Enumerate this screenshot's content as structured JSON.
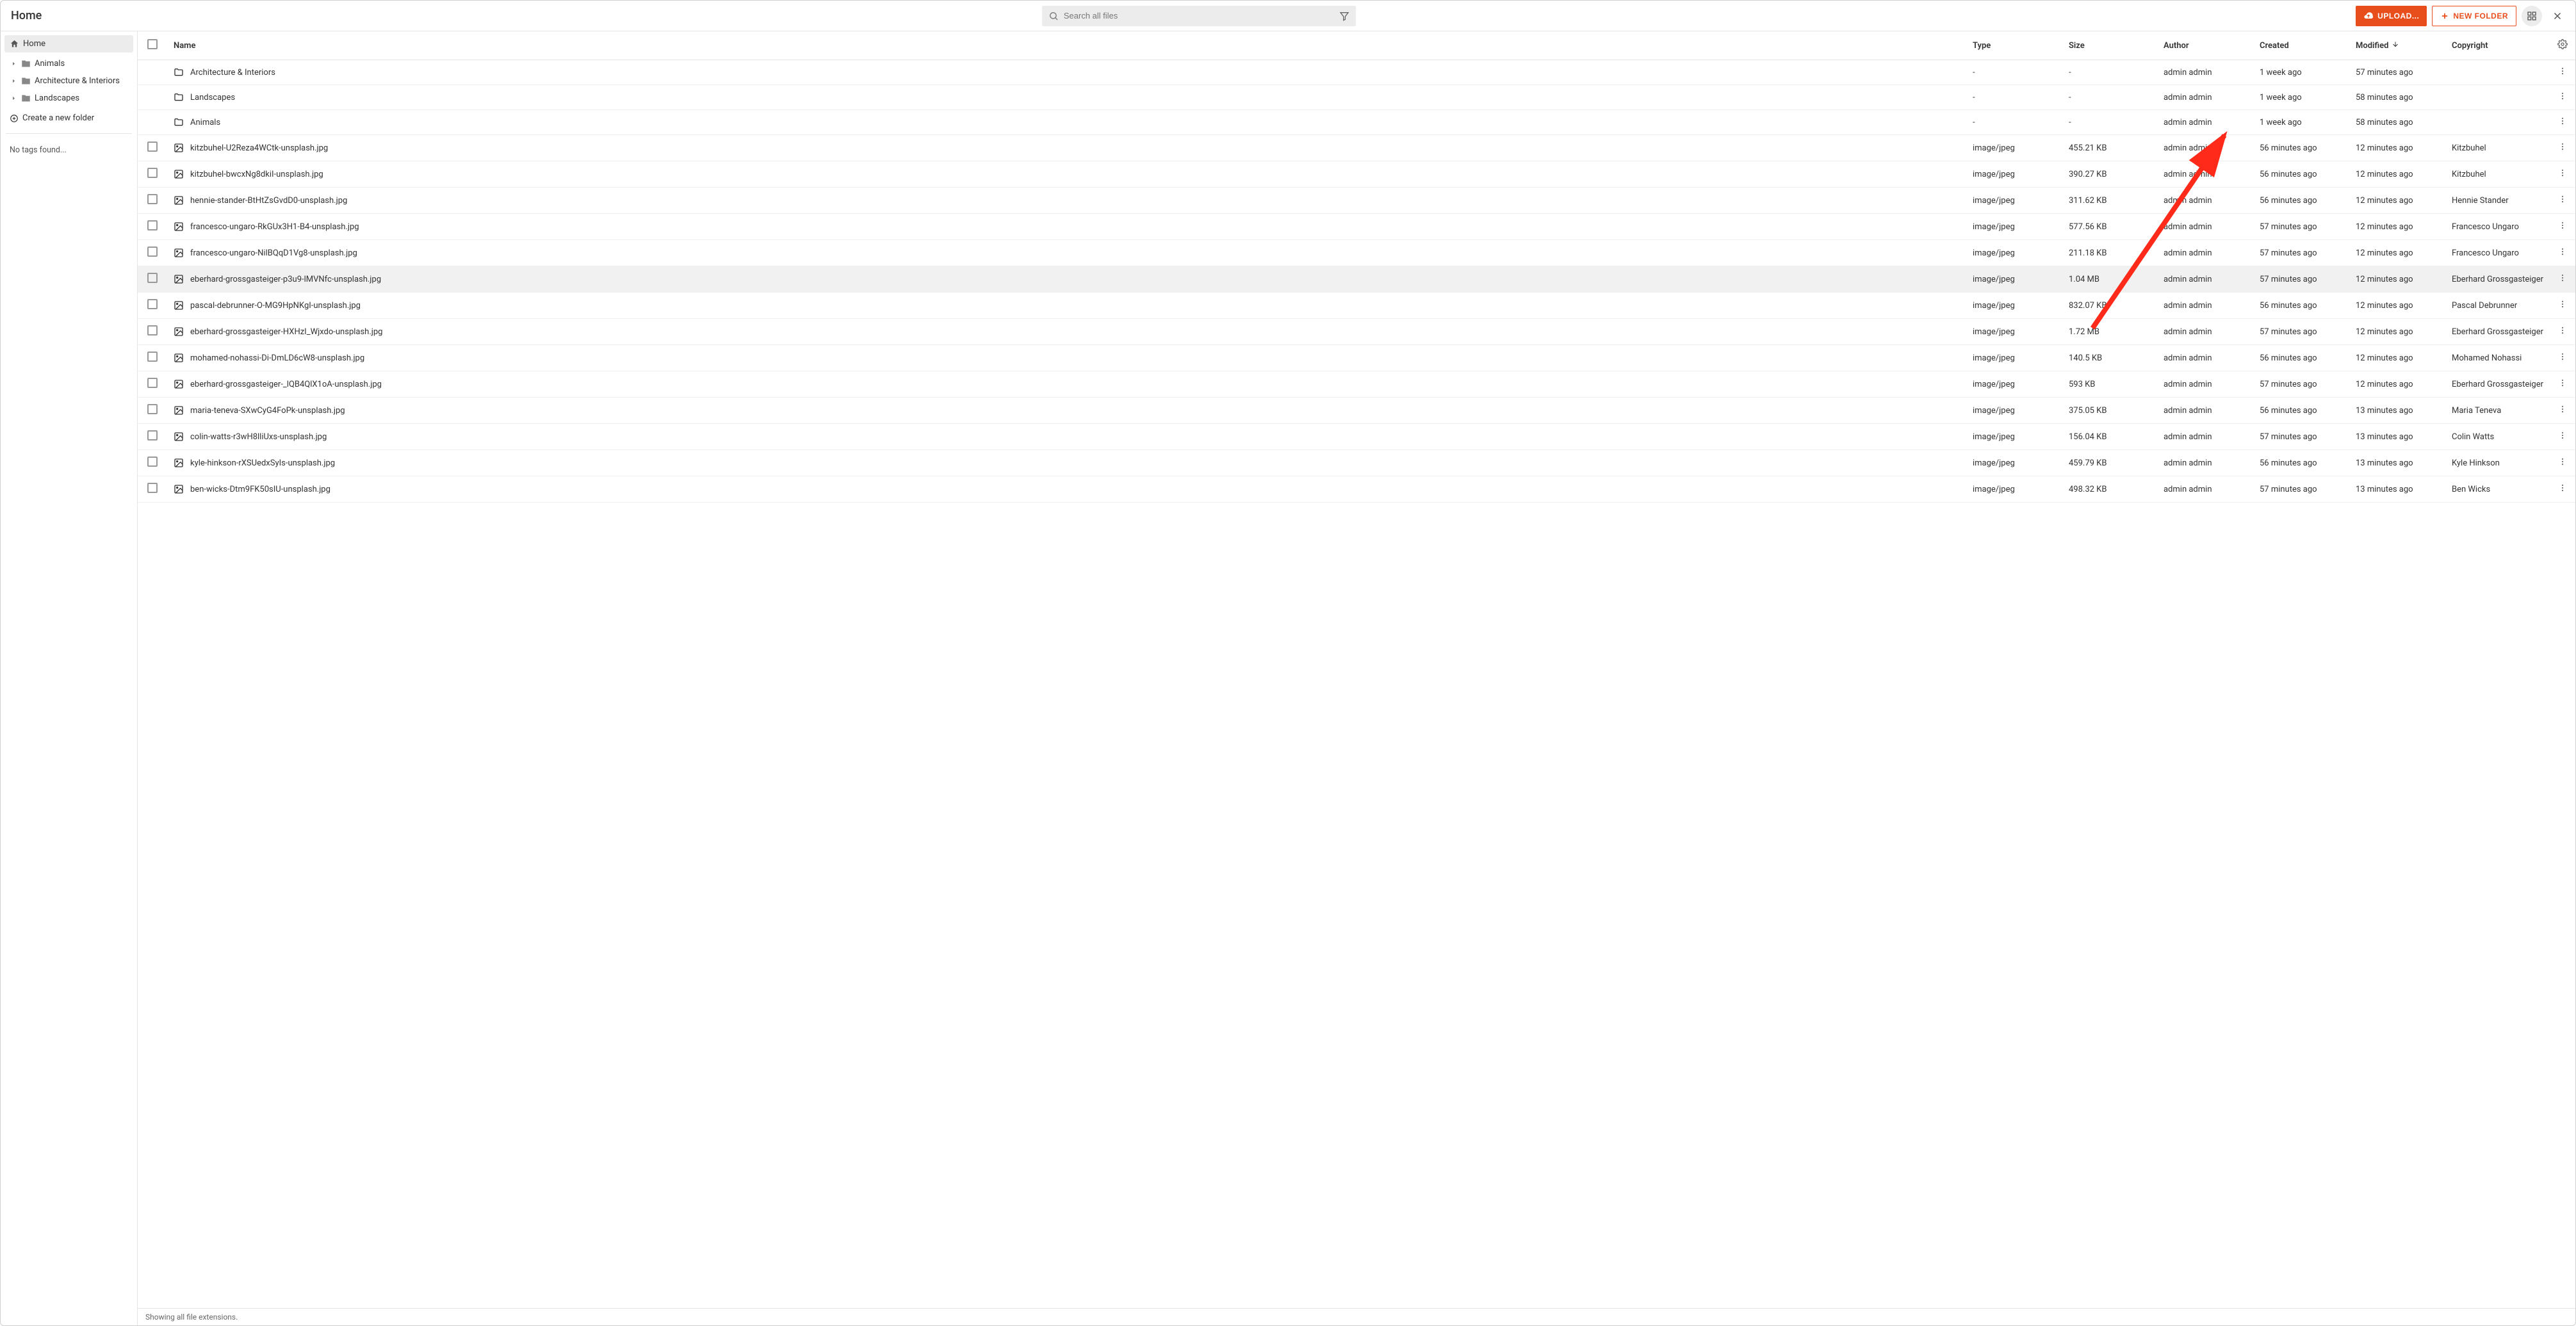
{
  "header": {
    "title": "Home",
    "search_placeholder": "Search all files",
    "upload_label": "UPLOAD...",
    "new_folder_label": "NEW FOLDER"
  },
  "sidebar": {
    "home_label": "Home",
    "folders": [
      {
        "label": "Animals"
      },
      {
        "label": "Architecture & Interiors"
      },
      {
        "label": "Landscapes"
      }
    ],
    "create_folder_label": "Create a new folder",
    "tags_note": "No tags found..."
  },
  "columns": {
    "name": "Name",
    "type": "Type",
    "size": "Size",
    "author": "Author",
    "created": "Created",
    "modified": "Modified",
    "copyright": "Copyright"
  },
  "rows": [
    {
      "kind": "folder",
      "name": "Architecture & Interiors",
      "type": "-",
      "size": "-",
      "author": "admin admin",
      "created": "1 week ago",
      "modified": "57 minutes ago",
      "copyright": ""
    },
    {
      "kind": "folder",
      "name": "Landscapes",
      "type": "-",
      "size": "-",
      "author": "admin admin",
      "created": "1 week ago",
      "modified": "58 minutes ago",
      "copyright": ""
    },
    {
      "kind": "folder",
      "name": "Animals",
      "type": "-",
      "size": "-",
      "author": "admin admin",
      "created": "1 week ago",
      "modified": "58 minutes ago",
      "copyright": ""
    },
    {
      "kind": "image",
      "name": "kitzbuhel-U2Reza4WCtk-unsplash.jpg",
      "type": "image/jpeg",
      "size": "455.21 KB",
      "author": "admin admin",
      "created": "56 minutes ago",
      "modified": "12 minutes ago",
      "copyright": "Kitzbuhel"
    },
    {
      "kind": "image",
      "name": "kitzbuhel-bwcxNg8dkiI-unsplash.jpg",
      "type": "image/jpeg",
      "size": "390.27 KB",
      "author": "admin admin",
      "created": "56 minutes ago",
      "modified": "12 minutes ago",
      "copyright": "Kitzbuhel"
    },
    {
      "kind": "image",
      "name": "hennie-stander-BtHtZsGvdD0-unsplash.jpg",
      "type": "image/jpeg",
      "size": "311.62 KB",
      "author": "admin admin",
      "created": "56 minutes ago",
      "modified": "12 minutes ago",
      "copyright": "Hennie Stander"
    },
    {
      "kind": "image",
      "name": "francesco-ungaro-RkGUx3H1-B4-unsplash.jpg",
      "type": "image/jpeg",
      "size": "577.56 KB",
      "author": "admin admin",
      "created": "57 minutes ago",
      "modified": "12 minutes ago",
      "copyright": "Francesco Ungaro"
    },
    {
      "kind": "image",
      "name": "francesco-ungaro-NilBQqD1Vg8-unsplash.jpg",
      "type": "image/jpeg",
      "size": "211.18 KB",
      "author": "admin admin",
      "created": "57 minutes ago",
      "modified": "12 minutes ago",
      "copyright": "Francesco Ungaro"
    },
    {
      "kind": "image",
      "hover": true,
      "name": "eberhard-grossgasteiger-p3u9-lMVNfc-unsplash.jpg",
      "type": "image/jpeg",
      "size": "1.04 MB",
      "author": "admin admin",
      "created": "57 minutes ago",
      "modified": "12 minutes ago",
      "copyright": "Eberhard Grossgasteiger"
    },
    {
      "kind": "image",
      "name": "pascal-debrunner-O-MG9HpNKgI-unsplash.jpg",
      "type": "image/jpeg",
      "size": "832.07 KB",
      "author": "admin admin",
      "created": "56 minutes ago",
      "modified": "12 minutes ago",
      "copyright": "Pascal Debrunner"
    },
    {
      "kind": "image",
      "name": "eberhard-grossgasteiger-HXHzI_Wjxdo-unsplash.jpg",
      "type": "image/jpeg",
      "size": "1.72 MB",
      "author": "admin admin",
      "created": "57 minutes ago",
      "modified": "12 minutes ago",
      "copyright": "Eberhard Grossgasteiger"
    },
    {
      "kind": "image",
      "name": "mohamed-nohassi-Di-DmLD6cW8-unsplash.jpg",
      "type": "image/jpeg",
      "size": "140.5 KB",
      "author": "admin admin",
      "created": "56 minutes ago",
      "modified": "12 minutes ago",
      "copyright": "Mohamed Nohassi"
    },
    {
      "kind": "image",
      "name": "eberhard-grossgasteiger-_lQB4QlX1oA-unsplash.jpg",
      "type": "image/jpeg",
      "size": "593 KB",
      "author": "admin admin",
      "created": "57 minutes ago",
      "modified": "12 minutes ago",
      "copyright": "Eberhard Grossgasteiger"
    },
    {
      "kind": "image",
      "name": "maria-teneva-SXwCyG4FoPk-unsplash.jpg",
      "type": "image/jpeg",
      "size": "375.05 KB",
      "author": "admin admin",
      "created": "56 minutes ago",
      "modified": "13 minutes ago",
      "copyright": "Maria Teneva"
    },
    {
      "kind": "image",
      "name": "colin-watts-r3wH8lliUxs-unsplash.jpg",
      "type": "image/jpeg",
      "size": "156.04 KB",
      "author": "admin admin",
      "created": "57 minutes ago",
      "modified": "13 minutes ago",
      "copyright": "Colin Watts"
    },
    {
      "kind": "image",
      "name": "kyle-hinkson-rXSUedxSyIs-unsplash.jpg",
      "type": "image/jpeg",
      "size": "459.79 KB",
      "author": "admin admin",
      "created": "56 minutes ago",
      "modified": "13 minutes ago",
      "copyright": "Kyle Hinkson"
    },
    {
      "kind": "image",
      "name": "ben-wicks-Dtm9FK50sIU-unsplash.jpg",
      "type": "image/jpeg",
      "size": "498.32 KB",
      "author": "admin admin",
      "created": "57 minutes ago",
      "modified": "13 minutes ago",
      "copyright": "Ben Wicks"
    }
  ],
  "footer": {
    "status": "Showing all file extensions."
  },
  "annotation": {
    "arrow_target": "copyright-column-header"
  },
  "colors": {
    "accent": "#e84e1b",
    "arrow": "#ff2a1a"
  }
}
